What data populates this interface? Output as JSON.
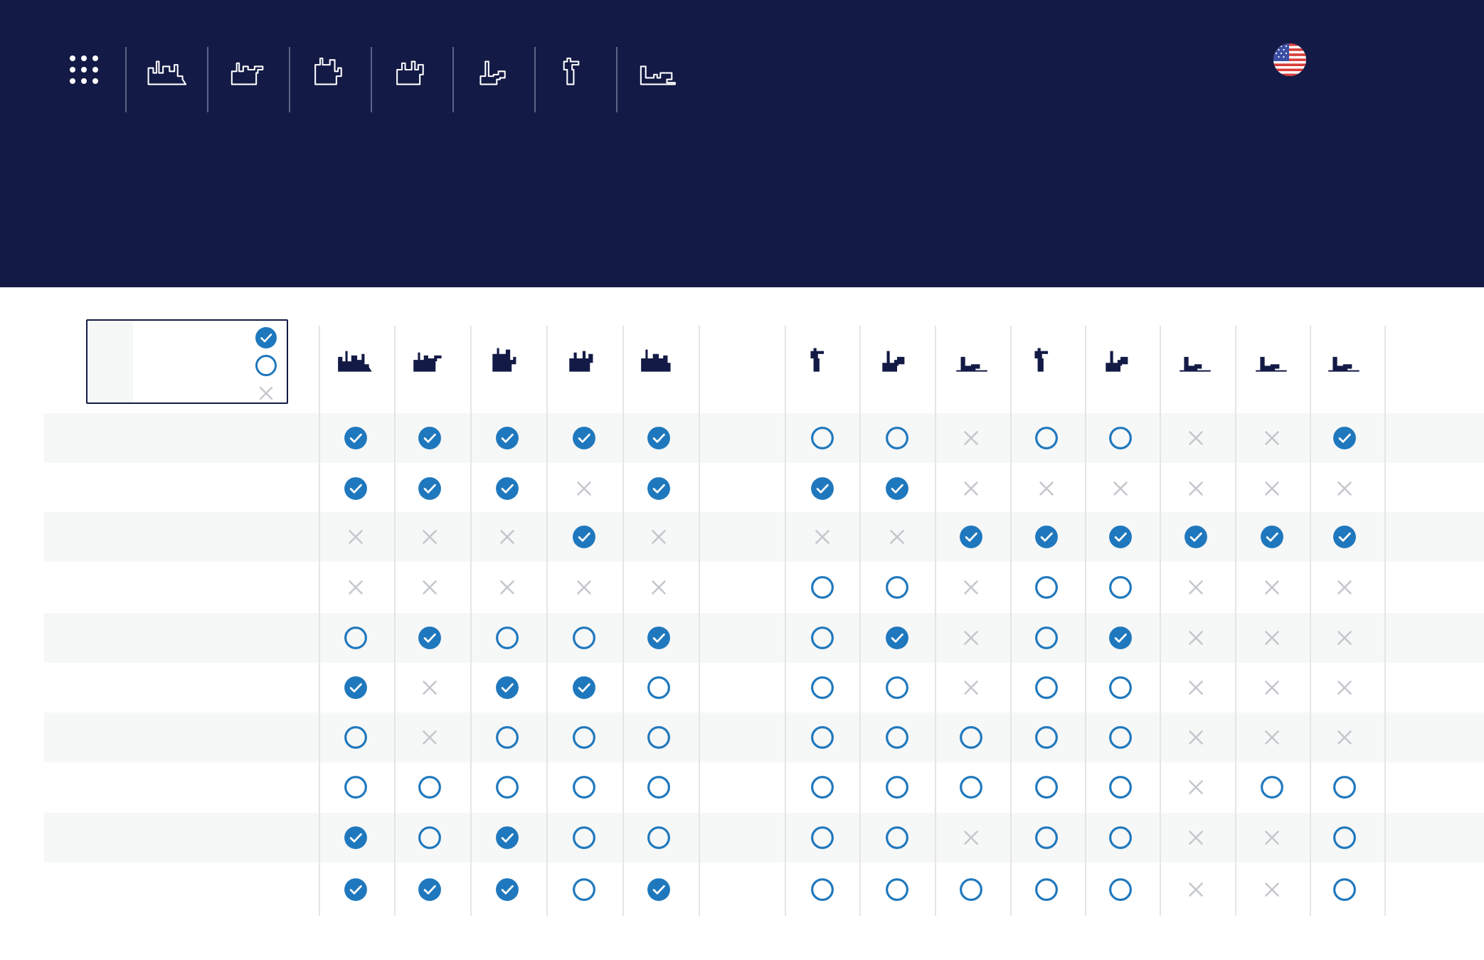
{
  "colors": {
    "header_bg": "#131a45",
    "accent": "#1f78bd",
    "x_mark": "#c4c7cc",
    "row_shade": "#f6f7f7",
    "column_rule": "#e3e5e8"
  },
  "header": {
    "apps_icon": "grid-dots-icon",
    "nav_items": [
      {
        "id": "model-1",
        "icon": "machine-large-cluster-icon"
      },
      {
        "id": "model-2",
        "icon": "machine-wide-icon"
      },
      {
        "id": "model-3",
        "icon": "machine-tall-icon"
      },
      {
        "id": "model-4",
        "icon": "machine-compact-icon"
      },
      {
        "id": "model-5",
        "icon": "machine-single-arm-icon"
      },
      {
        "id": "model-6",
        "icon": "machine-column-icon"
      },
      {
        "id": "model-7",
        "icon": "machine-bench-icon"
      }
    ],
    "language_flag": "us-flag-icon"
  },
  "legend": {
    "items": [
      {
        "status": "check",
        "label": ""
      },
      {
        "status": "circle",
        "label": ""
      },
      {
        "status": "x",
        "label": ""
      }
    ]
  },
  "comparison": {
    "group_a_columns": [
      "machine-cluster",
      "machine-wide",
      "machine-tall",
      "machine-compact",
      "machine-cluster-arm"
    ],
    "group_b_columns": [
      "column-a",
      "wide-b",
      "bench-c",
      "column-d",
      "wide-e",
      "bench-f",
      "bench-g",
      "bench-h"
    ],
    "rows": [
      {
        "label": "",
        "a": [
          "check",
          "check",
          "check",
          "check",
          "check"
        ],
        "b": [
          "circle",
          "circle",
          "x",
          "circle",
          "circle",
          "x",
          "x",
          "check"
        ]
      },
      {
        "label": "",
        "a": [
          "check",
          "check",
          "check",
          "x",
          "check"
        ],
        "b": [
          "check",
          "check",
          "x",
          "x",
          "x",
          "x",
          "x",
          "x"
        ]
      },
      {
        "label": "",
        "a": [
          "x",
          "x",
          "x",
          "check",
          "x"
        ],
        "b": [
          "x",
          "x",
          "check",
          "check",
          "check",
          "check",
          "check",
          "check"
        ]
      },
      {
        "label": "",
        "a": [
          "x",
          "x",
          "x",
          "x",
          "x"
        ],
        "b": [
          "circle",
          "circle",
          "x",
          "circle",
          "circle",
          "x",
          "x",
          "x"
        ]
      },
      {
        "label": "",
        "a": [
          "circle",
          "check",
          "circle",
          "circle",
          "check"
        ],
        "b": [
          "circle",
          "check",
          "x",
          "circle",
          "check",
          "x",
          "x",
          "x"
        ]
      },
      {
        "label": "",
        "a": [
          "check",
          "x",
          "check",
          "check",
          "circle"
        ],
        "b": [
          "circle",
          "circle",
          "x",
          "circle",
          "circle",
          "x",
          "x",
          "x"
        ]
      },
      {
        "label": "",
        "a": [
          "circle",
          "x",
          "circle",
          "circle",
          "circle"
        ],
        "b": [
          "circle",
          "circle",
          "circle",
          "circle",
          "circle",
          "x",
          "x",
          "x"
        ]
      },
      {
        "label": "",
        "a": [
          "circle",
          "circle",
          "circle",
          "circle",
          "circle"
        ],
        "b": [
          "circle",
          "circle",
          "circle",
          "circle",
          "circle",
          "x",
          "circle",
          "circle"
        ]
      },
      {
        "label": "",
        "a": [
          "check",
          "circle",
          "check",
          "circle",
          "circle"
        ],
        "b": [
          "circle",
          "circle",
          "x",
          "circle",
          "circle",
          "x",
          "x",
          "circle"
        ]
      },
      {
        "label": "",
        "a": [
          "check",
          "check",
          "check",
          "circle",
          "check"
        ],
        "b": [
          "circle",
          "circle",
          "circle",
          "circle",
          "circle",
          "x",
          "x",
          "circle"
        ]
      }
    ]
  }
}
